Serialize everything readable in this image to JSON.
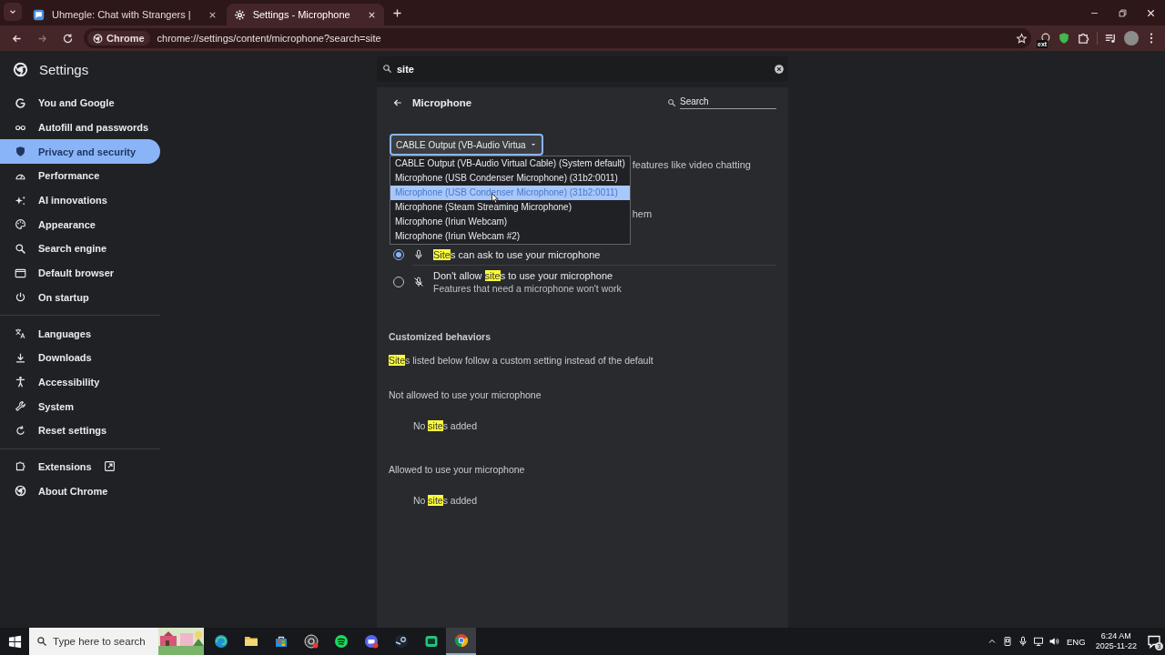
{
  "browser": {
    "tabs": [
      {
        "title": "Uhmegle: Chat with Strangers |",
        "kind": "site",
        "selected": false
      },
      {
        "title": "Settings - Microphone",
        "kind": "settings",
        "selected": true
      }
    ],
    "forward": {
      "disabled": true
    },
    "chip": "Chrome",
    "url": "chrome://settings/content/microphone?search=site",
    "extension_badge": "ext"
  },
  "settings": {
    "title": "Settings",
    "search": {
      "value": "site"
    },
    "nav_groups": [
      {
        "items": [
          {
            "label": "You and Google",
            "kind": "google",
            "selected": false
          },
          {
            "label": "Autofill and passwords",
            "kind": "key",
            "selected": false
          },
          {
            "label": "Privacy and security",
            "kind": "shield",
            "selected": true
          },
          {
            "label": "Performance",
            "kind": "gauge",
            "selected": false
          },
          {
            "label": "AI innovations",
            "kind": "sparkle",
            "selected": false
          },
          {
            "label": "Appearance",
            "kind": "palette",
            "selected": false
          },
          {
            "label": "Search engine",
            "kind": "search",
            "selected": false
          },
          {
            "label": "Default browser",
            "kind": "window",
            "selected": false
          },
          {
            "label": "On startup",
            "kind": "power",
            "selected": false
          }
        ]
      },
      {
        "items": [
          {
            "label": "Languages",
            "kind": "translate",
            "selected": false
          },
          {
            "label": "Downloads",
            "kind": "download",
            "selected": false
          },
          {
            "label": "Accessibility",
            "kind": "person",
            "selected": false
          },
          {
            "label": "System",
            "kind": "wrench",
            "selected": false
          },
          {
            "label": "Reset settings",
            "kind": "reset",
            "selected": false
          }
        ]
      },
      {
        "items": [
          {
            "label": "Extensions",
            "kind": "puzzle",
            "external": true,
            "selected": false
          },
          {
            "label": "About Chrome",
            "kind": "chrome",
            "selected": false
          }
        ]
      }
    ],
    "page": {
      "title": "Microphone",
      "search": {
        "placeholder": "Search"
      },
      "device_select": {
        "value": "CABLE Output (VB-Audio Virtua",
        "expanded": true,
        "options": [
          {
            "label": "CABLE Output (VB-Audio Virtual Cable) (System default)",
            "selected": false
          },
          {
            "label": "Microphone (USB Condenser Microphone) (31b2:0011)",
            "selected": false
          },
          {
            "label": "Microphone (USB Condenser Microphone) (31b2:0011)",
            "selected": true
          },
          {
            "label": "Microphone (Steam Streaming Microphone)",
            "selected": false
          },
          {
            "label": "Microphone (Iriun Webcam)",
            "selected": false
          },
          {
            "label": "Microphone (Iriun Webcam #2)",
            "selected": false
          }
        ]
      },
      "partial_lines": [
        "features like video chatting",
        "hem"
      ],
      "radios": [
        {
          "label": "**Site**s can ask to use your microphone",
          "kind": "mic",
          "selected": true
        },
        {
          "label": "Don't allow **site**s to use your microphone",
          "description": "Features that need a microphone won't work",
          "kind": "mic-off",
          "selected": false
        }
      ],
      "customized": {
        "heading": "Customized behaviors",
        "intro": "**Site**s listed below follow a custom setting instead of the default",
        "lists": [
          {
            "title": "Not allowed to use your microphone",
            "empty": "No **site**s added"
          },
          {
            "title": "Allowed to use your microphone",
            "empty": "No **site**s added"
          }
        ]
      }
    }
  },
  "taskbar": {
    "search": {
      "placeholder": "Type here to search"
    },
    "apps": [
      {
        "kind": "edge",
        "selected": false
      },
      {
        "kind": "folder",
        "selected": false
      },
      {
        "kind": "store",
        "selected": false
      },
      {
        "kind": "record",
        "selected": false
      },
      {
        "kind": "music",
        "selected": false
      },
      {
        "kind": "chat",
        "selected": false
      },
      {
        "kind": "steam",
        "selected": false
      },
      {
        "kind": "green",
        "selected": false
      },
      {
        "kind": "chrome",
        "selected": true
      }
    ],
    "language": "ENG",
    "time": "6:24 AM",
    "date": "2025-11-22",
    "notifications": "3"
  }
}
